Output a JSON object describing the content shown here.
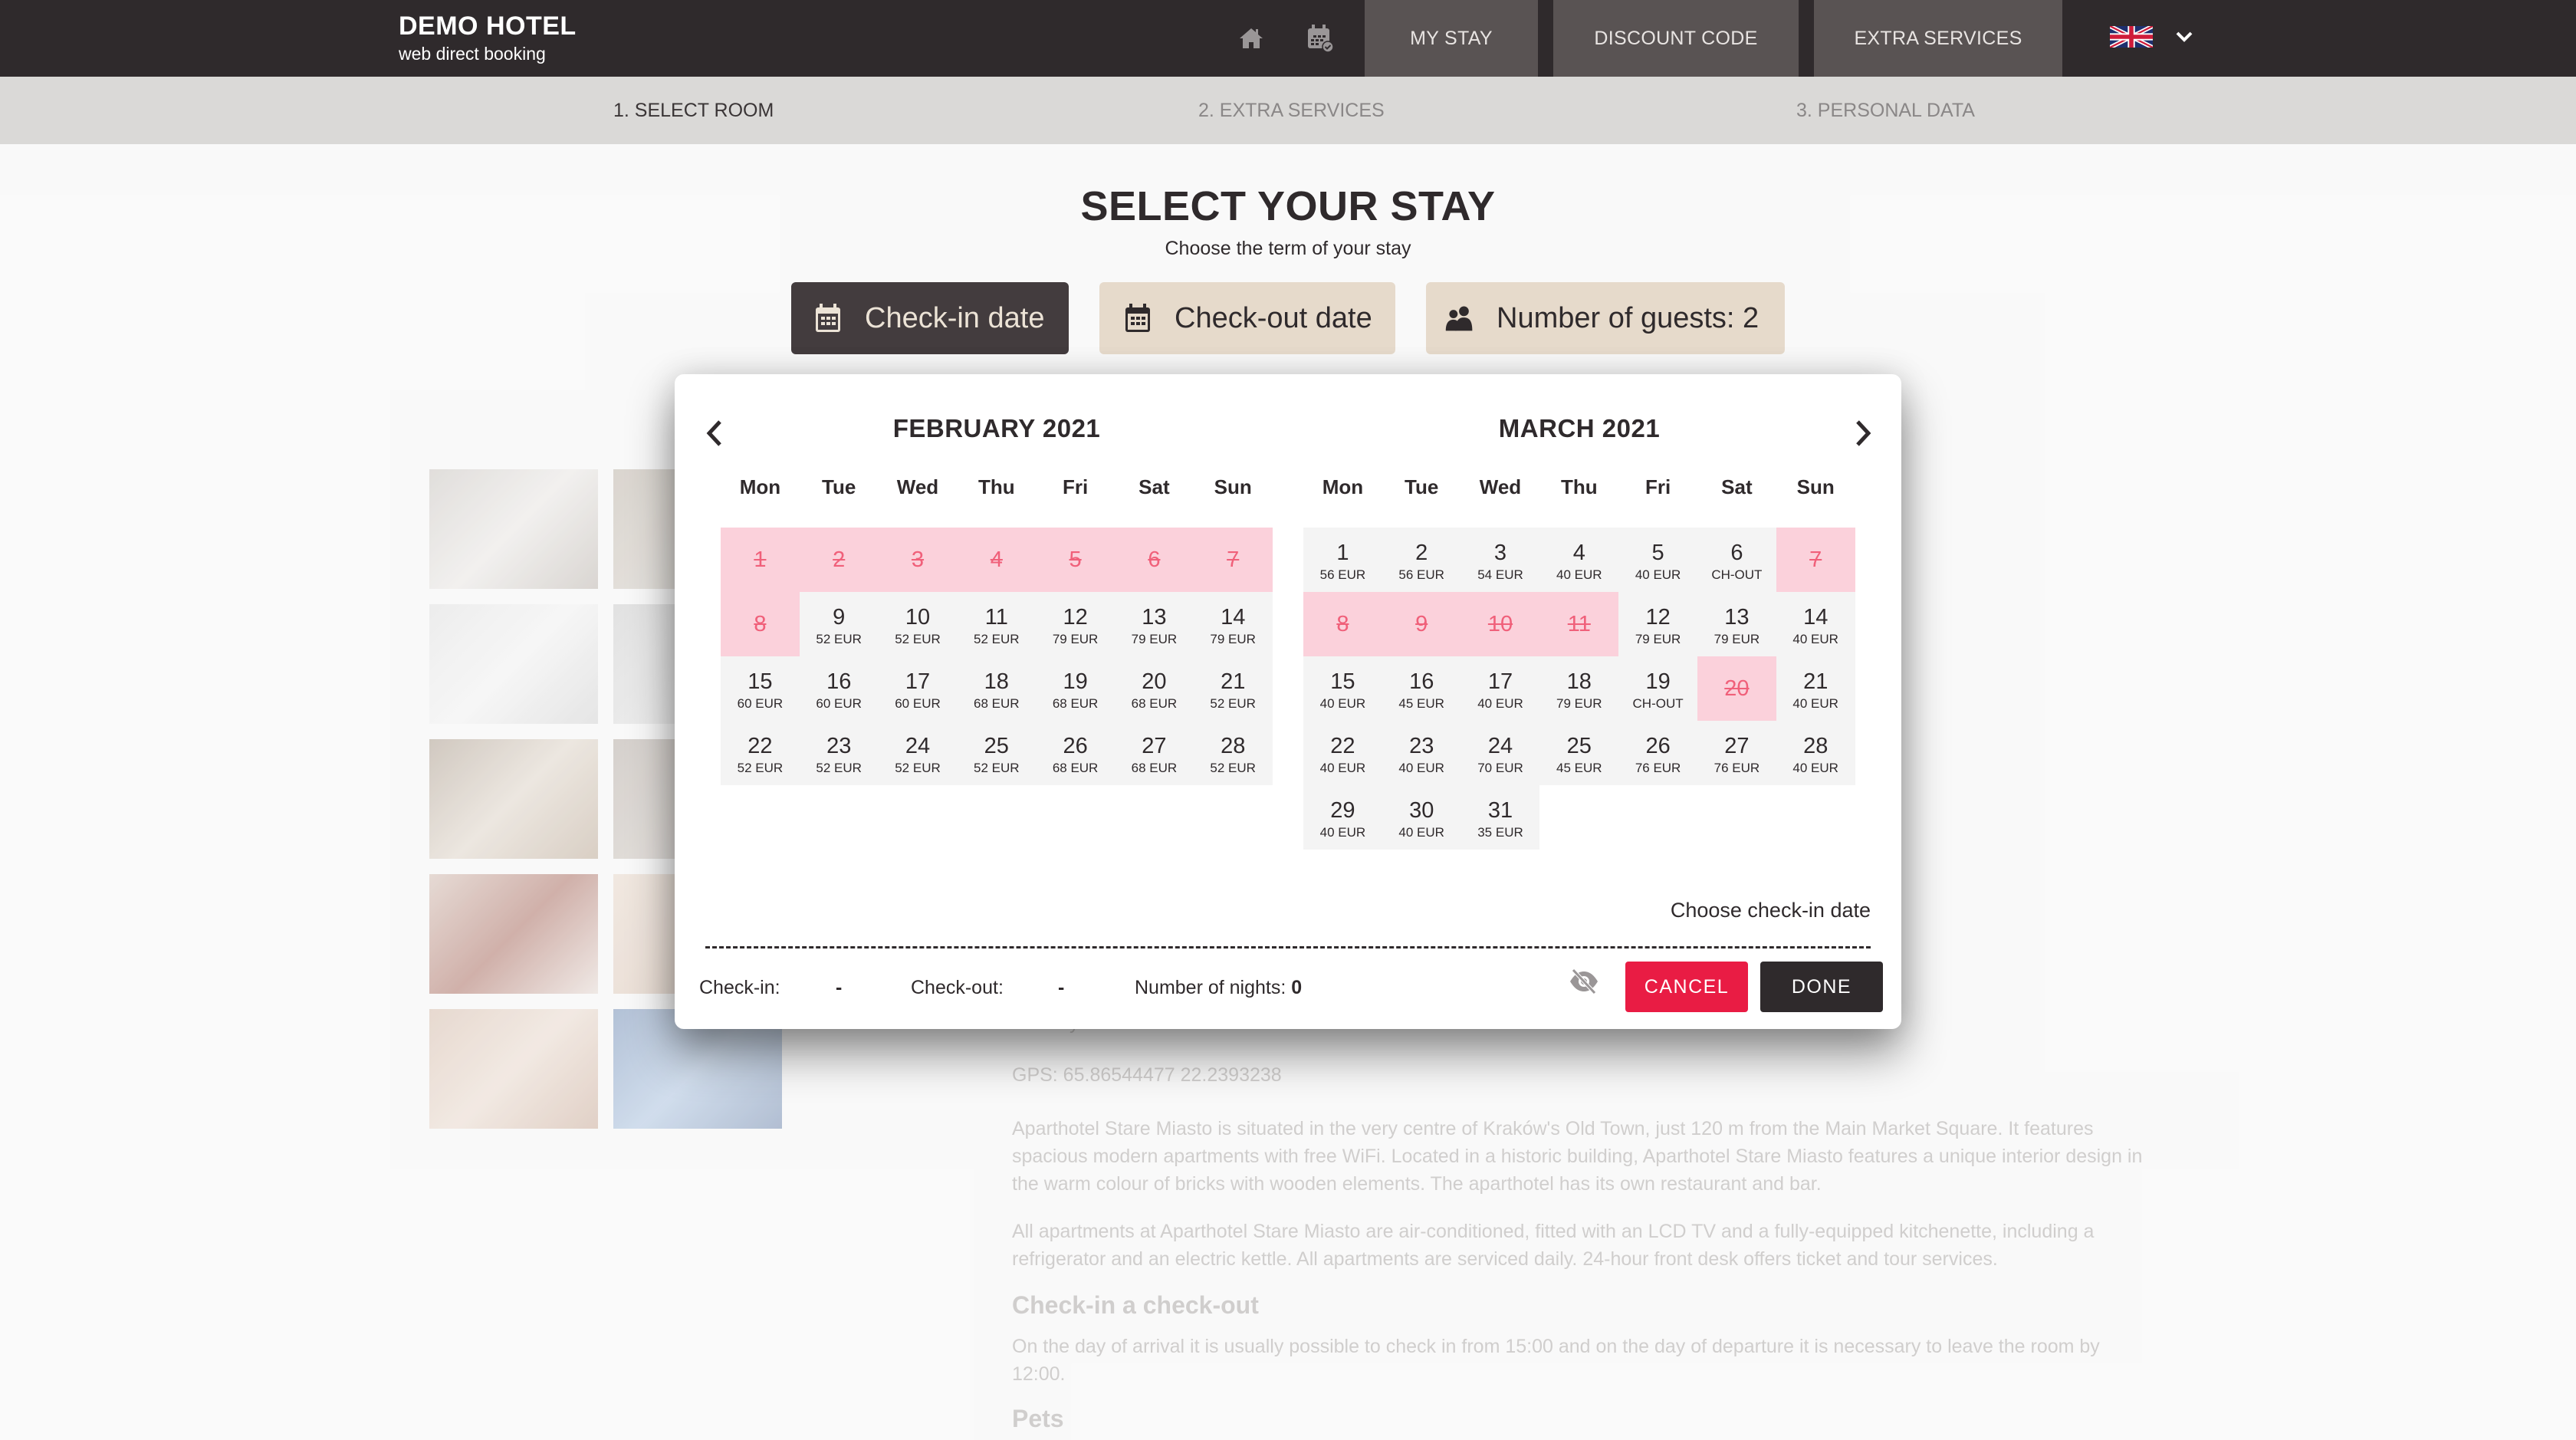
{
  "header": {
    "brand_title": "DEMO HOTEL",
    "brand_subtitle": "web direct booking",
    "icons": [
      "home-icon",
      "calendar-check-icon"
    ],
    "nav": [
      {
        "label": "MY STAY"
      },
      {
        "label": "DISCOUNT CODE"
      },
      {
        "label": "EXTRA SERVICES"
      }
    ],
    "language": {
      "flag": "uk-flag-icon",
      "dropdown": "chevron-down-icon"
    }
  },
  "steps": [
    {
      "label": "1. SELECT ROOM",
      "active": true
    },
    {
      "label": "2. EXTRA SERVICES",
      "active": false
    },
    {
      "label": "3. PERSONAL DATA",
      "active": false
    }
  ],
  "main": {
    "title": "SELECT YOUR STAY",
    "subtitle": "Choose the term of your stay",
    "checkin_button": "Check-in date",
    "checkout_button": "Check-out date",
    "guests_button": "Number of guests: 2"
  },
  "background": {
    "country_label": "Country",
    "gps": "GPS: 65.86544477  22.2393238",
    "paragraph1": "Aparthotel Stare Miasto is situated in the very centre of Kraków's Old Town, just 120 m from the Main Market Square. It features spacious modern apartments with free WiFi. Located in a historic building, Aparthotel Stare Miasto features a unique interior design in the warm colour of bricks with wooden elements. The aparthotel has its own restaurant and bar.",
    "paragraph2": "All apartments at Aparthotel Stare Miasto are air-conditioned, fitted with an LCD TV and a fully-equipped kitchenette, including a refrigerator and an electric kettle. All apartments are serviced daily. 24-hour front desk offers ticket and tour services.",
    "heading_checkin": "Check-in a check-out",
    "paragraph3": "On the day of arrival it is usually possible to check in from 15:00 and on the day of departure it is necessary to leave the room by 12:00.",
    "heading_pets": "Pets",
    "thumbnails": [
      "room-photo",
      "room-photo",
      "room-photo",
      "room-photo",
      "room-photo",
      "breakfast-photo",
      "spa-bath-photo",
      "spa-photo",
      "massage-photo",
      "bowling-photo"
    ]
  },
  "calendar": {
    "weekdays": [
      "Mon",
      "Tue",
      "Wed",
      "Thu",
      "Fri",
      "Sat",
      "Sun"
    ],
    "months": [
      {
        "title": "FEBRUARY 2021",
        "start_weekday": 0,
        "days": [
          {
            "d": "1",
            "blocked": true
          },
          {
            "d": "2",
            "blocked": true
          },
          {
            "d": "3",
            "blocked": true
          },
          {
            "d": "4",
            "blocked": true
          },
          {
            "d": "5",
            "blocked": true
          },
          {
            "d": "6",
            "blocked": true
          },
          {
            "d": "7",
            "blocked": true
          },
          {
            "d": "8",
            "blocked": true
          },
          {
            "d": "9",
            "p": "52 EUR"
          },
          {
            "d": "10",
            "p": "52 EUR"
          },
          {
            "d": "11",
            "p": "52 EUR"
          },
          {
            "d": "12",
            "p": "79 EUR"
          },
          {
            "d": "13",
            "p": "79 EUR"
          },
          {
            "d": "14",
            "p": "79 EUR"
          },
          {
            "d": "15",
            "p": "60 EUR"
          },
          {
            "d": "16",
            "p": "60 EUR"
          },
          {
            "d": "17",
            "p": "60 EUR"
          },
          {
            "d": "18",
            "p": "68 EUR"
          },
          {
            "d": "19",
            "p": "68 EUR"
          },
          {
            "d": "20",
            "p": "68 EUR"
          },
          {
            "d": "21",
            "p": "52 EUR"
          },
          {
            "d": "22",
            "p": "52 EUR"
          },
          {
            "d": "23",
            "p": "52 EUR"
          },
          {
            "d": "24",
            "p": "52 EUR"
          },
          {
            "d": "25",
            "p": "52 EUR"
          },
          {
            "d": "26",
            "p": "68 EUR"
          },
          {
            "d": "27",
            "p": "68 EUR"
          },
          {
            "d": "28",
            "p": "52 EUR"
          }
        ]
      },
      {
        "title": "MARCH 2021",
        "start_weekday": 0,
        "days": [
          {
            "d": "1",
            "p": "56 EUR"
          },
          {
            "d": "2",
            "p": "56 EUR"
          },
          {
            "d": "3",
            "p": "54 EUR"
          },
          {
            "d": "4",
            "p": "40 EUR"
          },
          {
            "d": "5",
            "p": "40 EUR"
          },
          {
            "d": "6",
            "p": "CH-OUT"
          },
          {
            "d": "7",
            "blocked": true
          },
          {
            "d": "8",
            "blocked": true
          },
          {
            "d": "9",
            "blocked": true
          },
          {
            "d": "10",
            "blocked": true
          },
          {
            "d": "11",
            "blocked": true
          },
          {
            "d": "12",
            "p": "79 EUR"
          },
          {
            "d": "13",
            "p": "79 EUR"
          },
          {
            "d": "14",
            "p": "40 EUR"
          },
          {
            "d": "15",
            "p": "40 EUR"
          },
          {
            "d": "16",
            "p": "45 EUR"
          },
          {
            "d": "17",
            "p": "40 EUR"
          },
          {
            "d": "18",
            "p": "79 EUR"
          },
          {
            "d": "19",
            "p": "CH-OUT"
          },
          {
            "d": "20",
            "blocked": true
          },
          {
            "d": "21",
            "p": "40 EUR"
          },
          {
            "d": "22",
            "p": "40 EUR"
          },
          {
            "d": "23",
            "p": "40 EUR"
          },
          {
            "d": "24",
            "p": "70 EUR"
          },
          {
            "d": "25",
            "p": "45 EUR"
          },
          {
            "d": "26",
            "p": "76 EUR"
          },
          {
            "d": "27",
            "p": "76 EUR"
          },
          {
            "d": "28",
            "p": "40 EUR"
          },
          {
            "d": "29",
            "p": "40 EUR"
          },
          {
            "d": "30",
            "p": "40 EUR"
          },
          {
            "d": "31",
            "p": "35 EUR"
          }
        ]
      }
    ],
    "hint": "Choose check-in date",
    "summary": {
      "checkin_label": "Check-in:",
      "checkin_value": "-",
      "checkout_label": "Check-out:",
      "checkout_value": "-",
      "nights_label": "Number of nights:",
      "nights_value": "0"
    },
    "cancel_label": "CANCEL",
    "done_label": "DONE"
  },
  "colors": {
    "header_bg": "#2f2a2c",
    "nav_button_bg": "#595353",
    "accent_red": "#e91c44",
    "blocked_day_bg": "#fbd1db",
    "blocked_day_text": "#f0607a",
    "available_day_bg": "#f4f4f4",
    "beige_button": "#e6dacb"
  }
}
